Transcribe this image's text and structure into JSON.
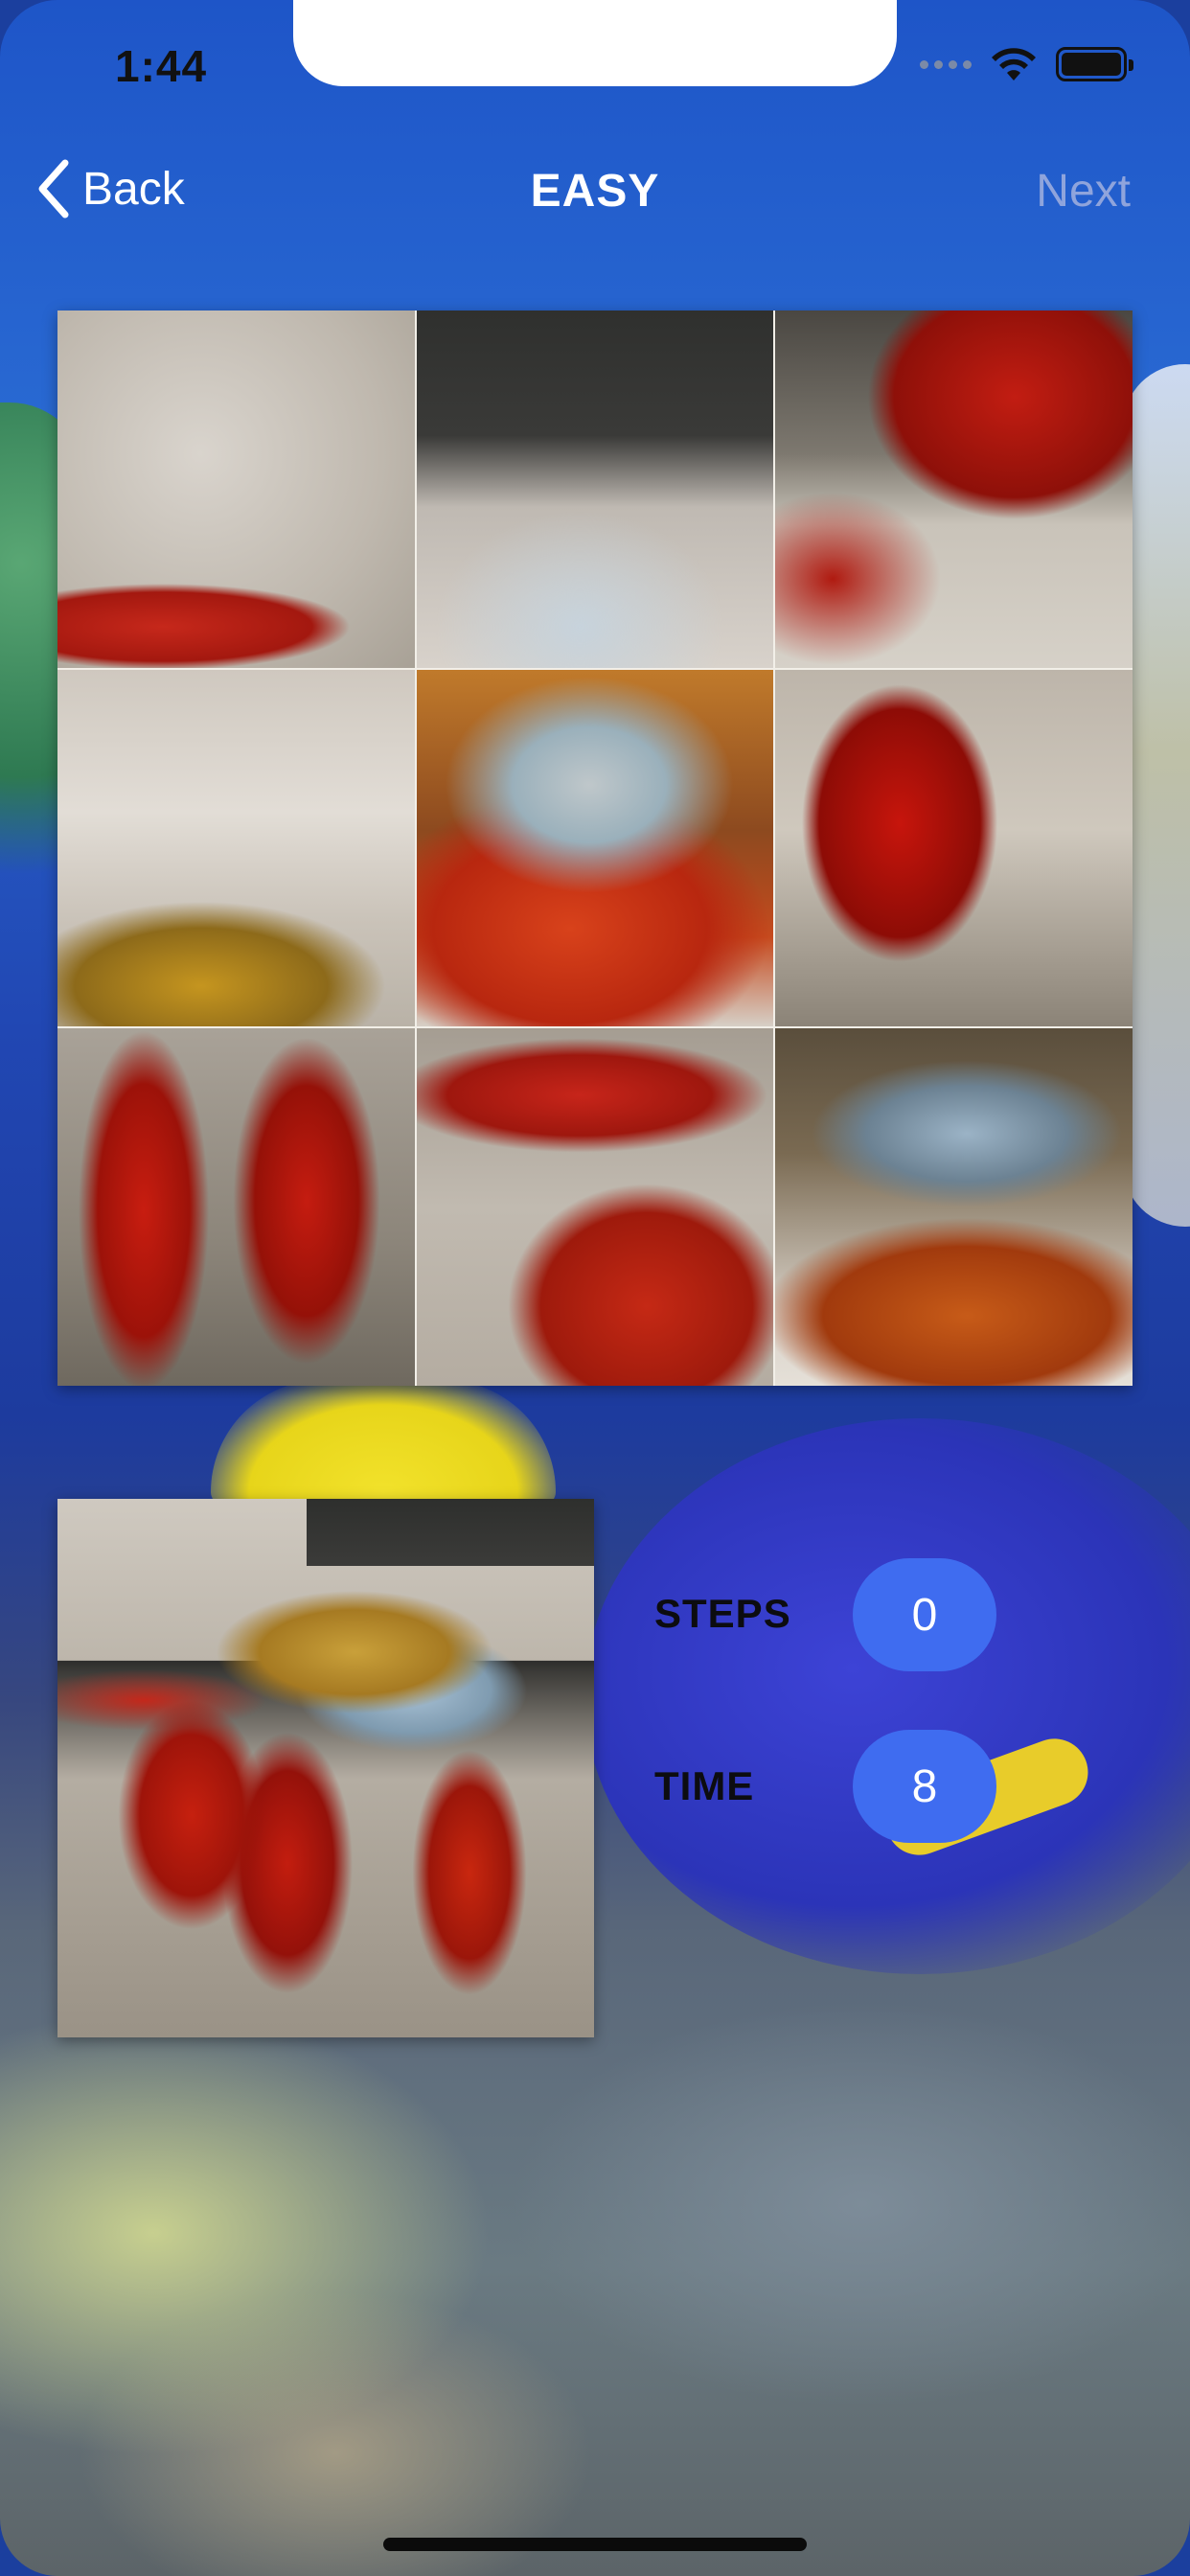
{
  "status_bar": {
    "time": "1:44",
    "icons": [
      "signal-icon",
      "wifi-icon",
      "battery-icon"
    ]
  },
  "nav": {
    "back_label": "Back",
    "title": "EASY",
    "next_label": "Next"
  },
  "puzzle": {
    "difficulty": "EASY",
    "tiles": [
      "tile-1",
      "tile-2",
      "tile-3",
      "tile-4",
      "tile-5",
      "tile-6",
      "tile-7",
      "tile-8",
      "tile-9"
    ]
  },
  "stats": {
    "steps_label": "STEPS",
    "steps_value": "0",
    "time_label": "TIME",
    "time_value": "8"
  },
  "colors": {
    "accent": "#3f6cf0",
    "nav_text": "#ffffff",
    "next_disabled": "#8fa4dc"
  }
}
